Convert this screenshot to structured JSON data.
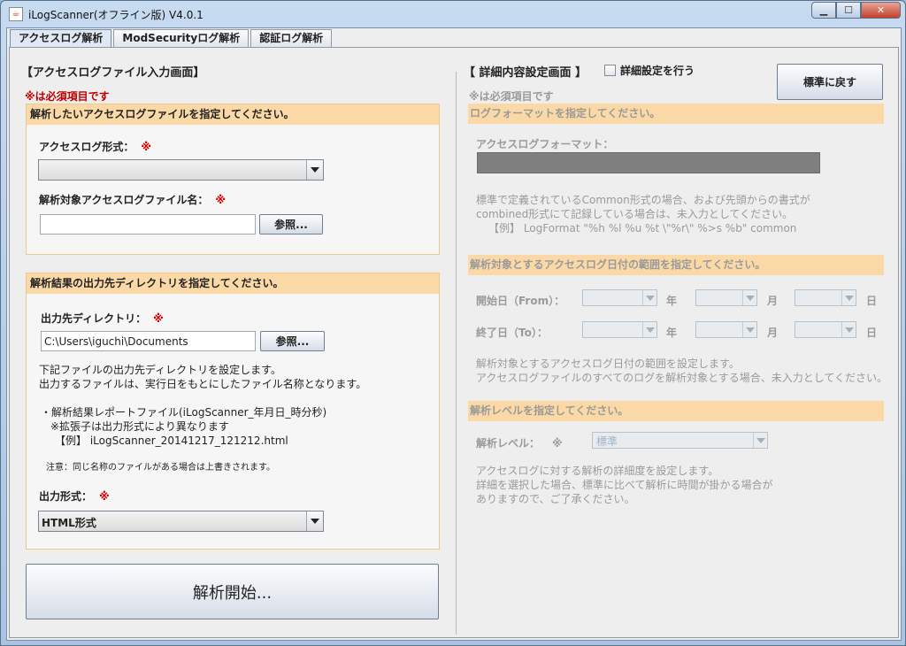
{
  "window": {
    "title": "iLogScanner(オフライン版) V4.0.1"
  },
  "tabs": [
    {
      "label": "アクセスログ解析"
    },
    {
      "label": "ModSecurityログ解析"
    },
    {
      "label": "認証ログ解析"
    }
  ],
  "left": {
    "title": "【アクセスログファイル入力画面】",
    "required_note": "※は必須項目です",
    "input_box": {
      "header": "解析したいアクセスログファイルを指定してください。",
      "format_label": "アクセスログ形式：",
      "format_value": "",
      "file_label": "解析対象アクセスログファイル名：",
      "file_value": "",
      "browse_label": "参照..."
    },
    "output_box": {
      "header": "解析結果の出力先ディレクトリを指定してください。",
      "dir_label": "出力先ディレクトリ：",
      "dir_value": "C:\\Users\\iguchi\\Documents",
      "browse_label": "参照...",
      "desc1": "下記ファイルの出力先ディレクトリを設定します。",
      "desc2": "出力するファイルは、実行日をもとにしたファイル名称となります。",
      "bullet1": "・解析結果レポートファイル(iLogScanner_年月日_時分秒)",
      "bullet2": "※拡張子は出力形式により異なります",
      "bullet3": "【例】 iLogScanner_20141217_121212.html",
      "note": "注意：同じ名称のファイルがある場合は上書きされます。",
      "format_label": "出力形式：",
      "format_value": "HTML形式"
    },
    "start_button": "解析開始..."
  },
  "required_mark": "※",
  "right": {
    "title": "【 詳細内容設定画面 】",
    "checkbox_label": "詳細設定を行う",
    "reset_button": "標準に戻す",
    "required_note": "※は必須項目です",
    "format_header": "ログフォーマットを指定してください。",
    "format_label": "アクセスログフォーマット：",
    "format_desc1": "標準で定義されているCommon形式の場合、および先頭からの書式が",
    "format_desc2": "combined形式にて記録している場合は、未入力としてください。",
    "format_example": "【例】 LogFormat \"%h %l %u %t \\\"%r\\\" %>s %b\" common",
    "date_header": "解析対象とするアクセスログ日付の範囲を指定してください。",
    "from_label": "開始日（From）：",
    "to_label": "終了日（To）：",
    "year": "年",
    "month": "月",
    "day": "日",
    "date_desc1": "解析対象とするアクセスログ日付の範囲を設定します。",
    "date_desc2": "アクセスログファイルのすべてのログを解析対象とする場合、未入力としてください。",
    "level_header": "解析レベルを指定してください。",
    "level_label": "解析レベル：",
    "level_value": "標準",
    "level_desc1": "アクセスログに対する解析の詳細度を設定します。",
    "level_desc2": "詳細を選択した場合、標準に比べて解析に時間が掛かる場合が",
    "level_desc3": "ありますので、ご了承ください。"
  }
}
